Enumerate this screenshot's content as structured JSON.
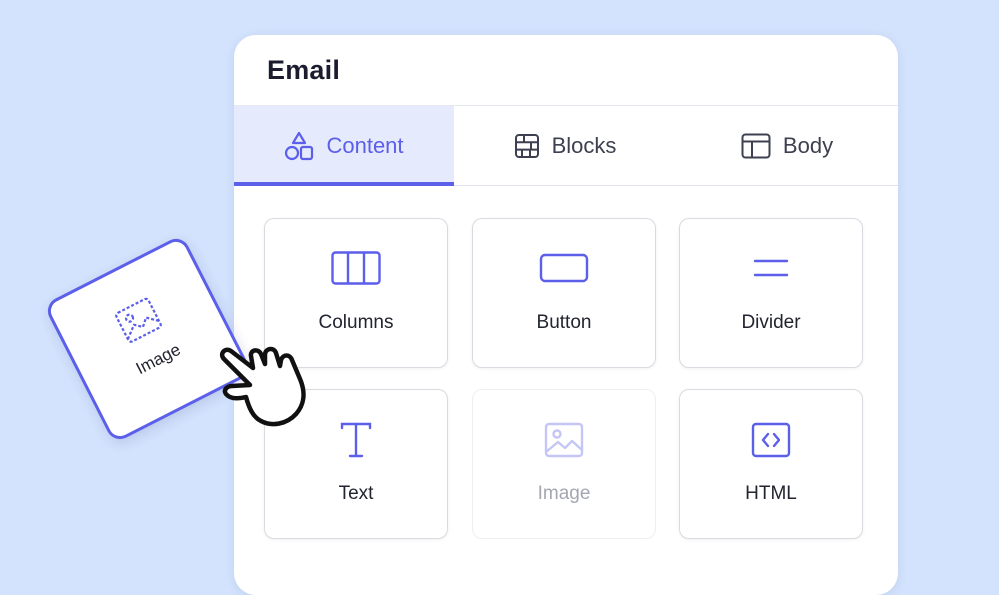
{
  "panel": {
    "title": "Email"
  },
  "tabs": [
    {
      "label": "Content",
      "icon": "shapes-icon",
      "active": true
    },
    {
      "label": "Blocks",
      "icon": "blocks-icon",
      "active": false
    },
    {
      "label": "Body",
      "icon": "layout-icon",
      "active": false
    }
  ],
  "cards": [
    {
      "label": "Columns",
      "icon": "columns-icon"
    },
    {
      "label": "Button",
      "icon": "button-icon"
    },
    {
      "label": "Divider",
      "icon": "divider-icon"
    },
    {
      "label": "Text",
      "icon": "text-icon"
    },
    {
      "label": "Image",
      "icon": "image-icon",
      "state": "placeholder"
    },
    {
      "label": "HTML",
      "icon": "code-icon"
    }
  ],
  "drag": {
    "label": "Image",
    "icon": "image-icon"
  },
  "colors": {
    "accent": "#5b5fe9",
    "background": "#d3e3fd",
    "tab_active_bg": "#e6eafd"
  }
}
